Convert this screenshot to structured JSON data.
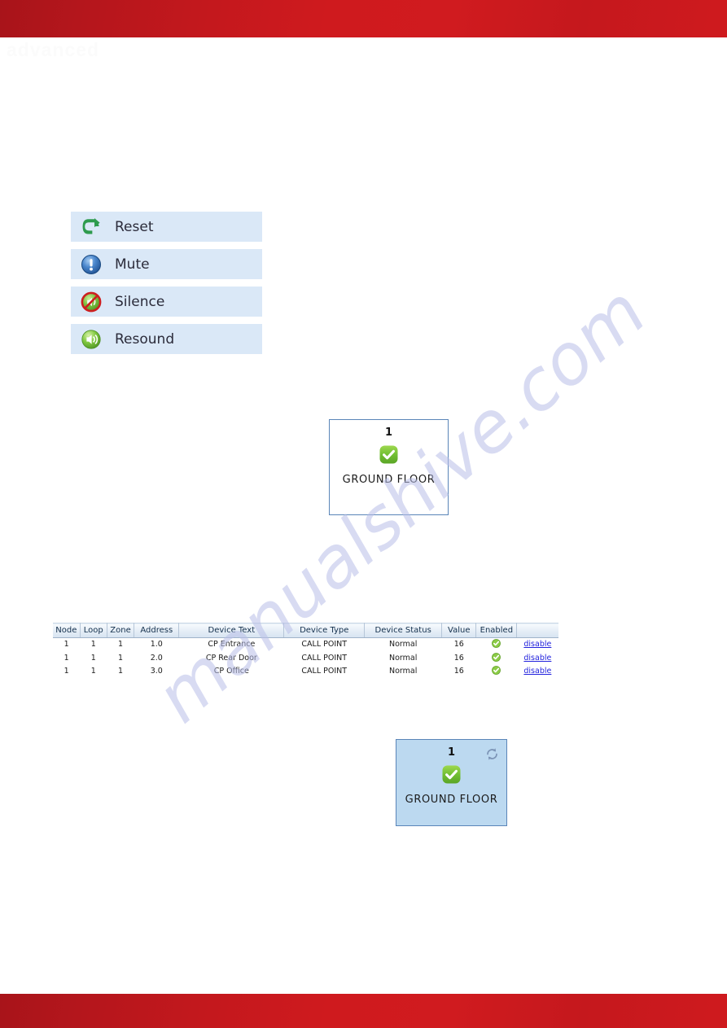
{
  "header": {
    "band_color": "#c5181d",
    "ghost_logo": "advanced"
  },
  "footer": {
    "band_color": "#c5181d"
  },
  "watermark": {
    "text": "manualshive.com",
    "color": "#b9bfe8"
  },
  "actions": {
    "buttons": [
      {
        "label": "Reset",
        "icon": "reset-arrow-icon",
        "icon_color": "#2e9b4e"
      },
      {
        "label": "Mute",
        "icon": "info-exclamation-icon",
        "icon_color": "#2f6fc0"
      },
      {
        "label": "Silence",
        "icon": "speaker-prohibited-icon",
        "icon_color": "#cc1f1f"
      },
      {
        "label": "Resound",
        "icon": "speaker-sound-icon",
        "icon_color": "#7ac943"
      }
    ]
  },
  "zones": {
    "top_panel": {
      "number": "1",
      "name": "GROUND FLOOR",
      "status_icon": "green-check-badge-icon",
      "background": "#ffffff",
      "border": "#5a85b8",
      "selected": false
    },
    "bottom_panel": {
      "number": "1",
      "name": "GROUND FLOOR",
      "status_icon": "green-check-badge-icon",
      "refresh_icon": "refresh-icon",
      "background": "#bcd9f0",
      "border": "#5a85b8",
      "selected": true
    }
  },
  "device_table": {
    "columns": [
      "Node",
      "Loop",
      "Zone",
      "Address",
      "Device Text",
      "Device Type",
      "Device Status",
      "Value",
      "Enabled",
      ""
    ],
    "rows": [
      {
        "node": "1",
        "loop": "1",
        "zone": "1",
        "address": "1.0",
        "device_text": "CP Entrance",
        "device_type": "CALL POINT",
        "device_status": "Normal",
        "value": "16",
        "enabled_icon": "green-check-icon",
        "action": "disable"
      },
      {
        "node": "1",
        "loop": "1",
        "zone": "1",
        "address": "2.0",
        "device_text": "CP Rear Door",
        "device_type": "CALL POINT",
        "device_status": "Normal",
        "value": "16",
        "enabled_icon": "green-check-icon",
        "action": "disable"
      },
      {
        "node": "1",
        "loop": "1",
        "zone": "1",
        "address": "3.0",
        "device_text": "CP Office",
        "device_type": "CALL POINT",
        "device_status": "Normal",
        "value": "16",
        "enabled_icon": "green-check-icon",
        "action": "disable"
      }
    ]
  }
}
